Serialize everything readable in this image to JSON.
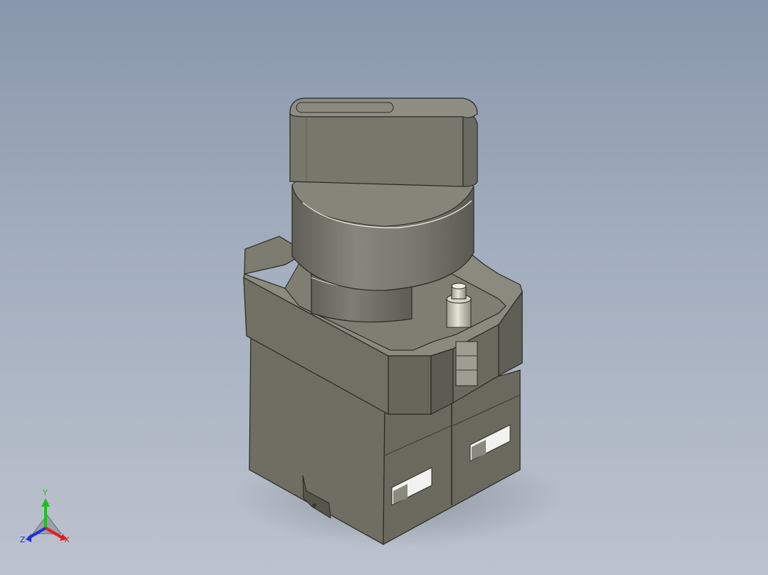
{
  "viewport": {
    "background_top": "#8897ab",
    "background_bottom": "#bcc3ce"
  },
  "model": {
    "part": "selector-switch",
    "body_color": "#6f6e63",
    "body_dark": "#5e5d53",
    "body_light": "#898a80",
    "knob_color": "#7a7a70",
    "pin_color": "#c9c7b9"
  },
  "triad": {
    "x_label": "X",
    "y_label": "Y",
    "z_label": "Z",
    "x_color": "#e02020",
    "y_color": "#20c020",
    "z_color": "#2030e0"
  }
}
